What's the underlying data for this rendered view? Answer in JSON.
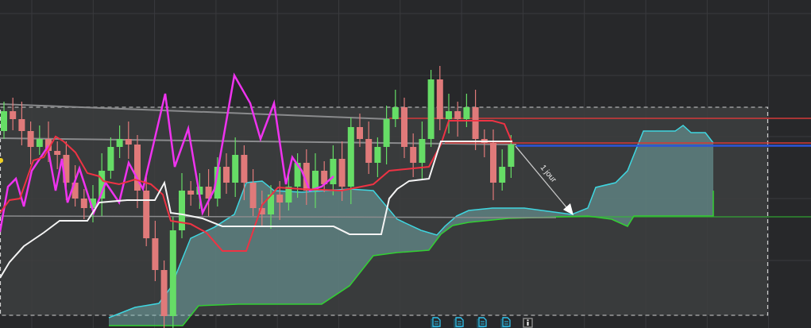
{
  "chart": {
    "annotation": {
      "label": "1 jour"
    }
  }
}
